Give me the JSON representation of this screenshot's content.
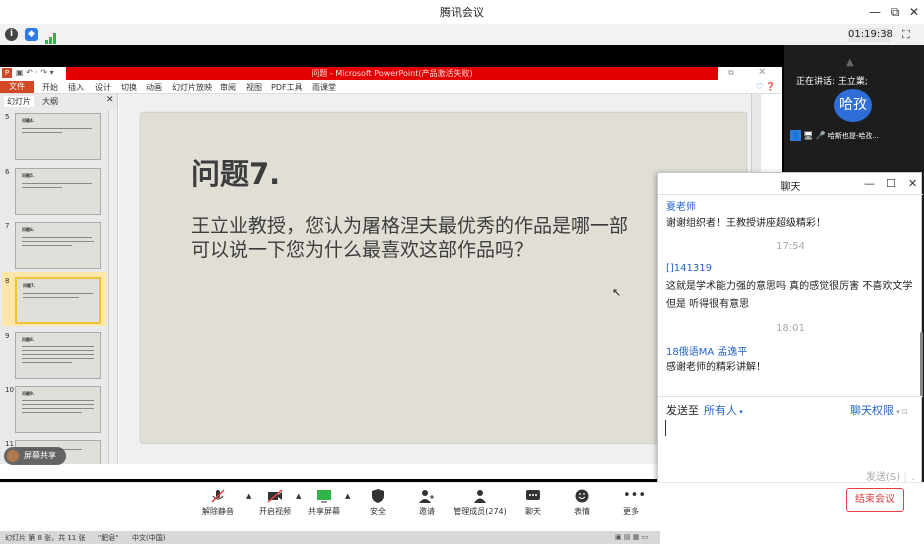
{
  "window": {
    "title": "腾讯会议",
    "minimize": "—",
    "restore": "⧉",
    "close": "✕"
  },
  "infobar": {
    "timer": "01:19:38"
  },
  "ppt": {
    "title": "问题 - Microsoft PowerPoint(产品激活失败)",
    "file_tab": "文件",
    "ribbon_tabs": [
      "开始",
      "插入",
      "设计",
      "切换",
      "动画",
      "幻灯片放映",
      "审阅",
      "视图",
      "PDF工具",
      "雨课堂"
    ],
    "pane_tabs": [
      "幻灯片",
      "大纲"
    ],
    "thumbnails": [
      {
        "num": "5",
        "title": "问题4."
      },
      {
        "num": "6",
        "title": "问题5."
      },
      {
        "num": "7",
        "title": "问题6."
      },
      {
        "num": "8",
        "title": "问题7."
      },
      {
        "num": "9",
        "title": "问题8."
      },
      {
        "num": "10",
        "title": "问题9."
      },
      {
        "num": "11",
        "title": ""
      }
    ],
    "slide": {
      "heading": "问题7.",
      "line1": "王立业教授，您认为屠格涅夫最优秀的作品是哪一部",
      "line2": "可以说一下您为什么最喜欢这部作品吗？"
    },
    "status": {
      "slide_pos": "幻灯片 第 8 张，共 11 张",
      "theme": "\"肥皂\"",
      "lang": "中文(中国)"
    }
  },
  "participants": {
    "speaking": "正在讲话: 王立業;",
    "avatar_text": "哈孜",
    "participant_name": "哈斯也提-哈孜..."
  },
  "screen_share_name": "屏幕共享",
  "chat": {
    "title": "聊天",
    "messages": [
      {
        "sender": "夏老师",
        "text": "谢谢组织者！王教授讲座超级精彩！"
      },
      {
        "time": "17:54"
      },
      {
        "sender": "[]141319",
        "text": "这就是学术能力强的意思吗 真的感觉很厉害 不喜欢文学但是 听得很有意思"
      },
      {
        "time": "18:01"
      },
      {
        "sender": "18俄语MA 孟逸平",
        "text": "感谢老师的精彩讲解！"
      }
    ],
    "send_to_label": "发送至",
    "send_to_value": "所有人",
    "permission": "聊天权限",
    "send_button": "发送(S)"
  },
  "toolbar": {
    "items": [
      {
        "label": "解除静音",
        "icon": "mic-muted-icon"
      },
      {
        "label": "开启视频",
        "icon": "camera-off-icon"
      },
      {
        "label": "共享屏幕",
        "icon": "screen-share-icon"
      },
      {
        "label": "安全",
        "icon": "shield-icon"
      },
      {
        "label": "邀请",
        "icon": "invite-icon"
      },
      {
        "label": "管理成员(274)",
        "icon": "members-icon"
      },
      {
        "label": "聊天",
        "icon": "chat-icon"
      },
      {
        "label": "表情",
        "icon": "emoji-icon"
      },
      {
        "label": "更多",
        "icon": "more-icon"
      }
    ],
    "end_meeting": "结束会议"
  },
  "colors": {
    "accent": "#2464c8",
    "ppt_red": "#e20000",
    "end_red": "#e04040"
  }
}
